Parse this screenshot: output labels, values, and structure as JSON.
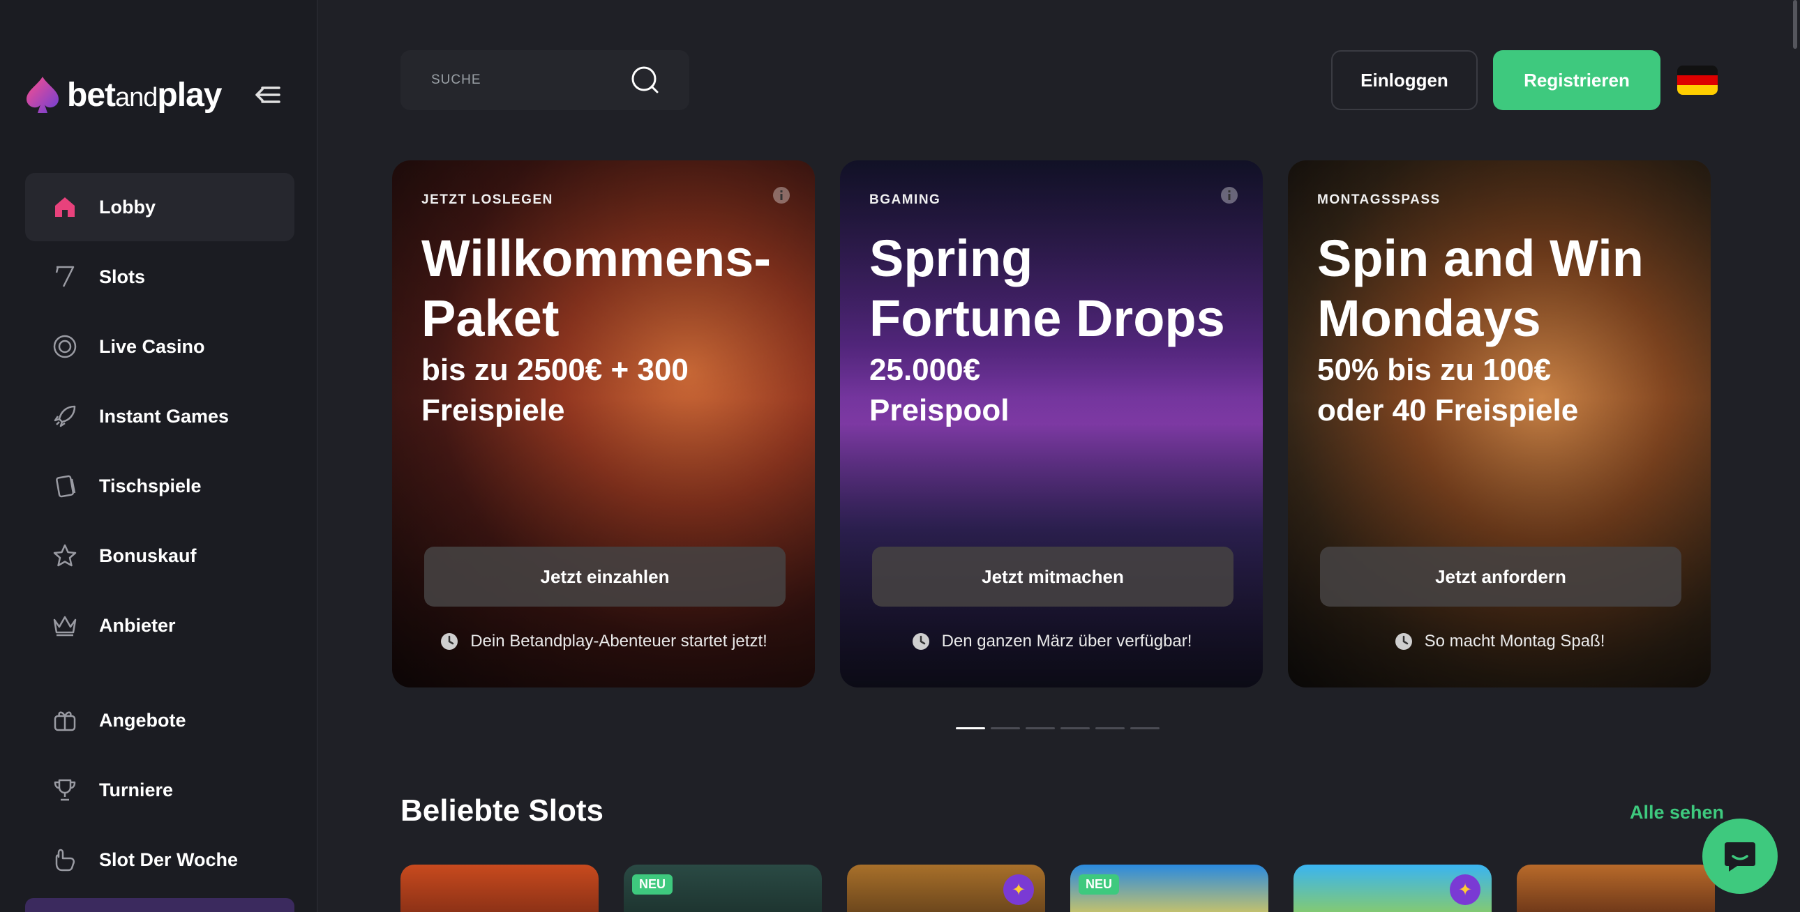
{
  "brand": {
    "name_bet": "bet",
    "name_and": "and",
    "name_play": "play"
  },
  "search": {
    "placeholder": "SUCHE"
  },
  "header": {
    "login_label": "Einloggen",
    "register_label": "Registrieren"
  },
  "sidebar": {
    "items": [
      {
        "label": "Lobby",
        "icon": "home-icon",
        "active": true
      },
      {
        "label": "Slots",
        "icon": "seven-icon"
      },
      {
        "label": "Live Casino",
        "icon": "chip-icon"
      },
      {
        "label": "Instant Games",
        "icon": "rocket-icon"
      },
      {
        "label": "Tischspiele",
        "icon": "cards-icon"
      },
      {
        "label": "Bonuskauf",
        "icon": "star-icon"
      },
      {
        "label": "Anbieter",
        "icon": "crown-icon"
      }
    ],
    "items2": [
      {
        "label": "Angebote",
        "icon": "gift-icon"
      },
      {
        "label": "Turniere",
        "icon": "trophy-icon"
      },
      {
        "label": "Slot Der Woche",
        "icon": "hand-icon"
      }
    ]
  },
  "promos": [
    {
      "eyebrow": "JETZT LOSLEGEN",
      "title_line1": "Willkommens-",
      "title_line2": "Paket",
      "sub_line1": "bis zu 2500€ + 300",
      "sub_line2": "Freispiele",
      "cta": "Jetzt einzahlen",
      "footnote": "Dein Betandplay-Abenteuer startet jetzt!"
    },
    {
      "eyebrow": "BGAMING",
      "title_line1": "Spring",
      "title_line2": "Fortune Drops",
      "sub_line1": "25.000€",
      "sub_line2": "Preispool",
      "cta": "Jetzt mitmachen",
      "footnote": "Den ganzen März über verfügbar!"
    },
    {
      "eyebrow": "MONTAGSSPASS",
      "title_line1": "Spin and Win",
      "title_line2": "Mondays",
      "sub_line1": "50% bis zu 100€",
      "sub_line2": "oder 40 Freispiele",
      "cta": "Jetzt anfordern",
      "footnote": "So macht Montag Spaß!"
    }
  ],
  "carousel": {
    "pages": 6,
    "active_index": 0
  },
  "popular": {
    "title": "Beliebte Slots",
    "see_all": "Alle sehen",
    "badge_new": "NEU"
  },
  "colors": {
    "accent": "#3ec97e",
    "brand_pink": "#e8427c",
    "sidebar": "#1b1c22",
    "background": "#1f2026"
  }
}
